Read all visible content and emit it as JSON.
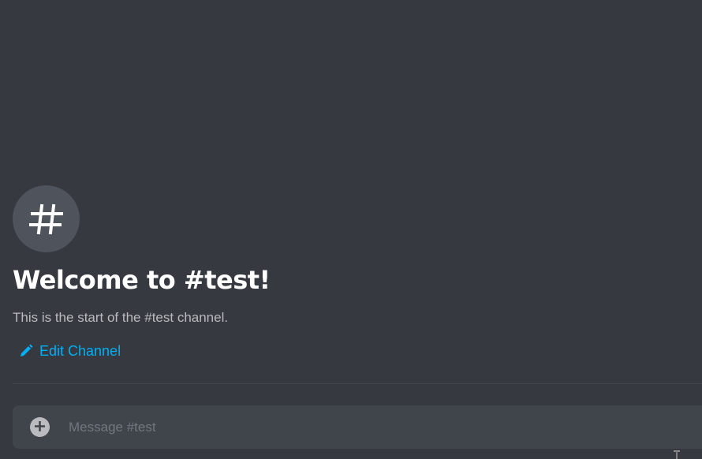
{
  "channel": {
    "icon": "hashtag-icon",
    "welcome_title": "Welcome to #test!",
    "welcome_subtitle": "This is the start of the #test channel.",
    "edit_label": "Edit Channel"
  },
  "composer": {
    "placeholder": "Message #test",
    "value": "",
    "attach_icon": "plus-circle-icon"
  },
  "colors": {
    "background": "#36393f",
    "icon_circle": "#4f545c",
    "link": "#00b0f4",
    "composer_bg": "#40444b",
    "placeholder": "#72767d"
  }
}
